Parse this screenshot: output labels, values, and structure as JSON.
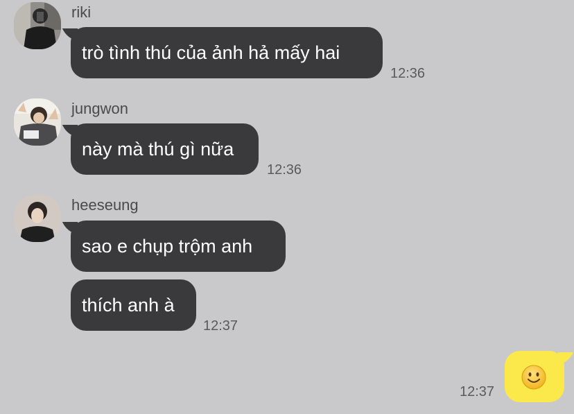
{
  "messages": [
    {
      "sender": "riki",
      "avatar_icon": "riki-avatar",
      "bubbles": [
        "trò tình thú của ảnh hả mấy hai"
      ],
      "time": "12:36"
    },
    {
      "sender": "jungwon",
      "avatar_icon": "jungwon-avatar",
      "bubbles": [
        "này mà thú gì nữa"
      ],
      "time": "12:36"
    },
    {
      "sender": "heeseung",
      "avatar_icon": "heeseung-avatar",
      "bubbles": [
        "sao e chụp trộm anh",
        "thích anh à"
      ],
      "time": "12:37"
    }
  ],
  "my_message": {
    "content_icon": "smiling-face-emoji-icon",
    "time": "12:37"
  },
  "colors": {
    "background": "#c9c9cb",
    "received_bubble": "#3a3a3c",
    "sent_bubble": "#fbe84a"
  }
}
